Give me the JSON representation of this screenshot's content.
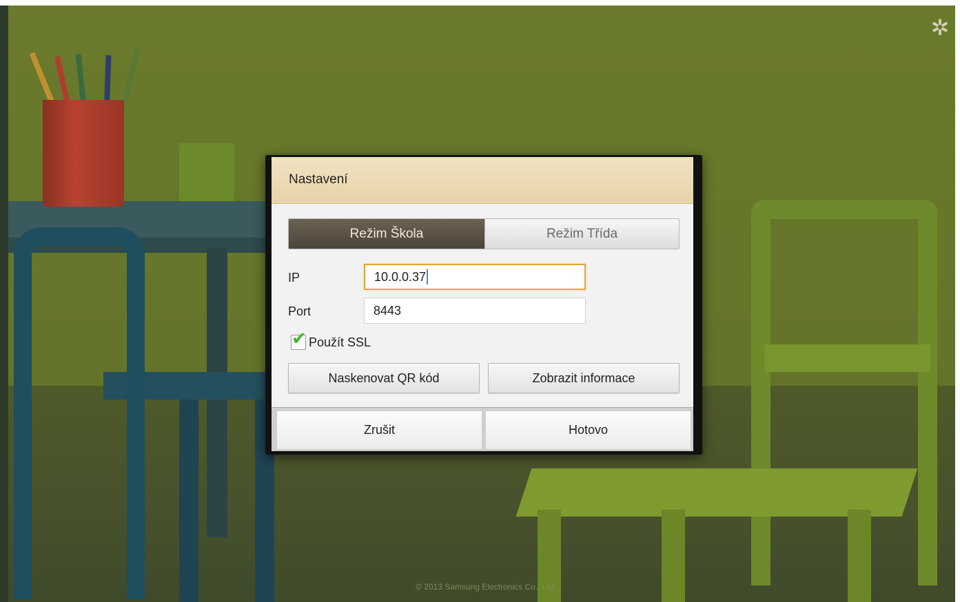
{
  "background": {
    "copyright": "© 2013 Samsung Electronics Co., Ltd.",
    "settings_icon": "gear-icon"
  },
  "dialog": {
    "title": "Nastavení",
    "mode_tabs": [
      {
        "label": "Režim Škola",
        "selected": true
      },
      {
        "label": "Režim Třída",
        "selected": false
      }
    ],
    "ip": {
      "label": "IP",
      "value": "10.0.0.37",
      "focused": true
    },
    "port": {
      "label": "Port",
      "value": "8443"
    },
    "ssl": {
      "label": "Použít SSL",
      "checked": true,
      "icon": "checkmark-icon"
    },
    "actions": {
      "scan_qr": "Naskenovat QR kód",
      "show_info": "Zobrazit informace"
    },
    "footer": {
      "cancel": "Zrušit",
      "done": "Hotovo"
    }
  },
  "colors": {
    "header_bg": "#ecdab4",
    "selected_tab_bg": "#5a5245",
    "focus_border": "#e8a337",
    "checkmark": "#46b52a"
  }
}
